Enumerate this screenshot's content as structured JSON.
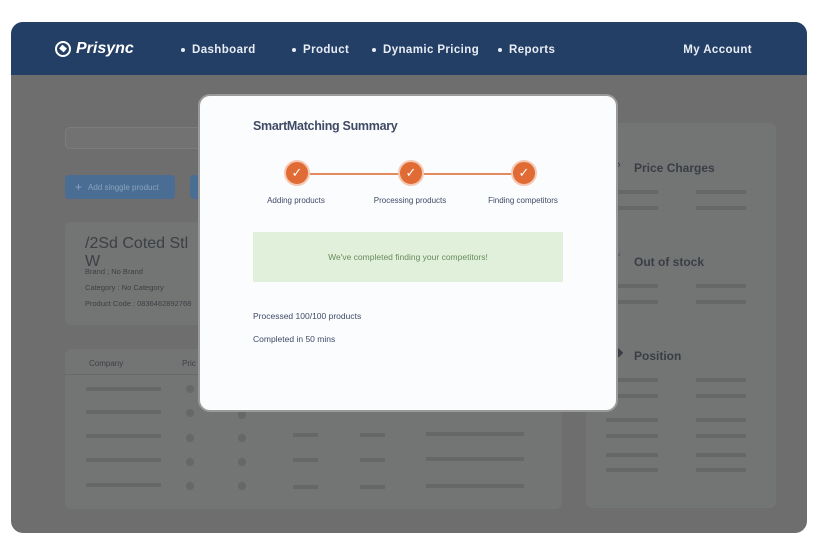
{
  "nav": {
    "logo": "Prisync",
    "items": [
      "Dashboard",
      "Product",
      "Dynamic Pricing",
      "Reports"
    ],
    "account": "My Account"
  },
  "background": {
    "add_button": "Add singgle product",
    "product": {
      "title": "/2Sd Coted Stl W",
      "brand": "Brand ; No Brand",
      "category": "Category : No Category",
      "code": "Product Code : 0836462892768"
    },
    "table_headers": [
      "Company",
      "Pric"
    ],
    "side": [
      {
        "title": "Price Charges",
        "icon": "price-change-icon"
      },
      {
        "title": "Out of stock",
        "icon": "out-of-stock-icon"
      },
      {
        "title": "Position",
        "icon": "position-icon"
      }
    ]
  },
  "modal": {
    "title": "SmartMatching Summary",
    "steps": [
      {
        "label": "Adding products",
        "done": true
      },
      {
        "label": "Processing products",
        "done": true
      },
      {
        "label": "Finding competitors",
        "done": true
      }
    ],
    "check": "✓",
    "alert": "We've completed finding your competitors!",
    "processed": "Processed 100/100 products",
    "completed": "Completed in 50 mins"
  },
  "colors": {
    "nav": "#243f66",
    "accent": "#e06b35",
    "success_bg": "#e0f0da"
  }
}
